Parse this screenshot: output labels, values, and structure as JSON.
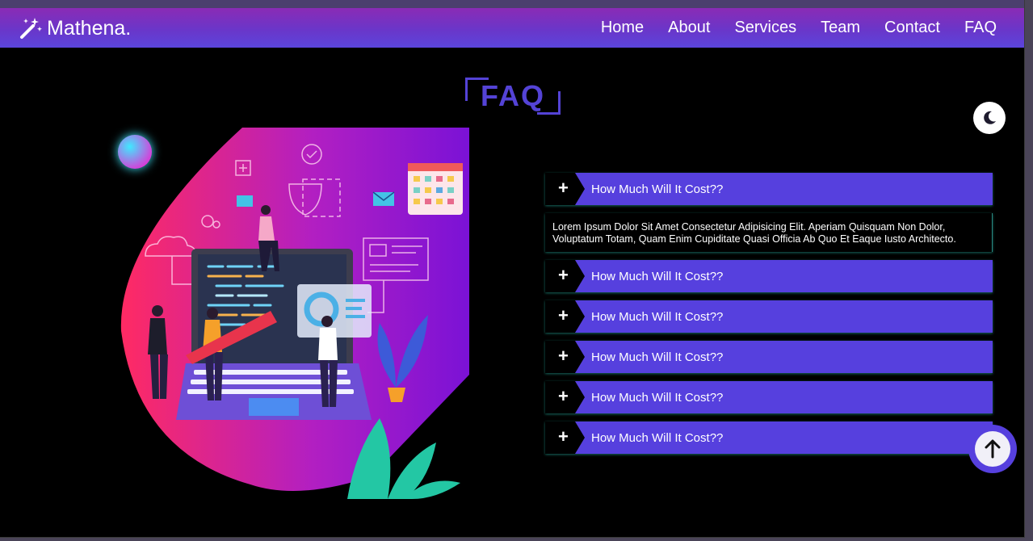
{
  "navbar": {
    "brand": "Mathena.",
    "links": [
      "Home",
      "About",
      "Services",
      "Team",
      "Contact",
      "FAQ"
    ]
  },
  "section": {
    "title": "FAQ"
  },
  "faq": {
    "items": [
      {
        "question": "How Much Will It Cost??",
        "expanded": true,
        "answer": "Lorem Ipsum Dolor Sit Amet Consectetur Adipisicing Elit. Aperiam Quisquam Non Dolor, Voluptatum Totam, Quam Enim Cupiditate Quasi Officia Ab Quo Et Eaque Iusto Architecto."
      },
      {
        "question": "How Much Will It Cost??",
        "expanded": false
      },
      {
        "question": "How Much Will It Cost??",
        "expanded": false
      },
      {
        "question": "How Much Will It Cost??",
        "expanded": false
      },
      {
        "question": "How Much Will It Cost??",
        "expanded": false
      },
      {
        "question": "How Much Will It Cost??",
        "expanded": false
      }
    ],
    "toggle_symbol": "+"
  },
  "icons": {
    "brand": "magic-wand-icon",
    "theme": "moon-icon",
    "scroll": "arrow-up-icon"
  },
  "colors": {
    "accent": "#5640de",
    "nav_top": "#8a2bb5",
    "nav_bottom": "#5b45dc",
    "glow": "#28beaa"
  }
}
